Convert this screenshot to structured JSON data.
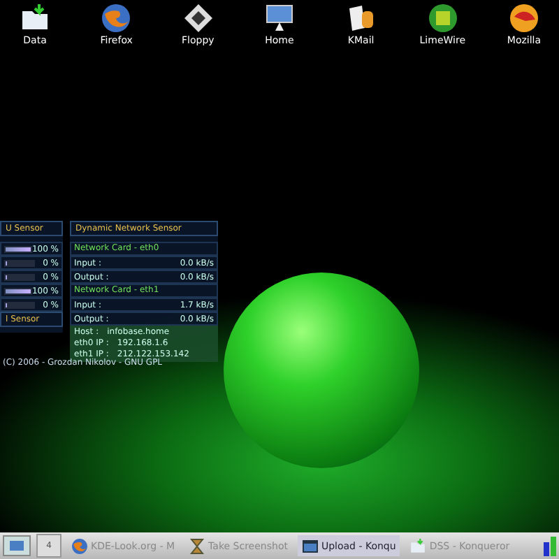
{
  "desktop_icons": [
    {
      "label": "Data",
      "kind": "folder"
    },
    {
      "label": "Firefox",
      "kind": "firefox"
    },
    {
      "label": "Floppy",
      "kind": "floppy"
    },
    {
      "label": "Home",
      "kind": "home"
    },
    {
      "label": "KMail",
      "kind": "mail"
    },
    {
      "label": "LimeWire",
      "kind": "limewire"
    },
    {
      "label": "Mozilla",
      "kind": "mozilla"
    }
  ],
  "cpu_sensor": {
    "title": "U Sensor",
    "rows": [
      {
        "reading": "100 %",
        "level": 1
      },
      {
        "reading": "0 %",
        "level": 0
      },
      {
        "reading": "0 %",
        "level": 0
      },
      {
        "reading": "100 %",
        "level": 1
      },
      {
        "reading": "0 %",
        "level": 0
      }
    ],
    "footer": "l Sensor"
  },
  "network_sensor": {
    "title": "Dynamic Network Sensor",
    "cards": [
      {
        "name": "Network Card - eth0",
        "rows": [
          {
            "label": "Input :",
            "value": "0.0 kB/s"
          },
          {
            "label": "Output :",
            "value": "0.0 kB/s"
          }
        ]
      },
      {
        "name": "Network Card - eth1",
        "rows": [
          {
            "label": "Input :",
            "value": "1.7 kB/s"
          },
          {
            "label": "Output :",
            "value": "0.0 kB/s"
          }
        ]
      }
    ],
    "host": [
      {
        "label": "Host :",
        "value": "infobase.home"
      },
      {
        "label": "eth0 IP :",
        "value": "192.168.1.6"
      },
      {
        "label": "eth1 IP :",
        "value": "212.122.153.142"
      }
    ],
    "credit": "(C) 2006 - Grozdan Nikolov - GNU GPL"
  },
  "taskbar": {
    "pager": "4",
    "tasks": [
      {
        "label": "KDE-Look.org - M",
        "kind": "firefox",
        "selected": false
      },
      {
        "label": "Take Screenshot",
        "kind": "hourglass",
        "selected": false
      },
      {
        "label": "Upload - Konqu",
        "kind": "window",
        "selected": true
      },
      {
        "label": "DSS - Konqueror",
        "kind": "folder",
        "selected": false
      }
    ]
  }
}
